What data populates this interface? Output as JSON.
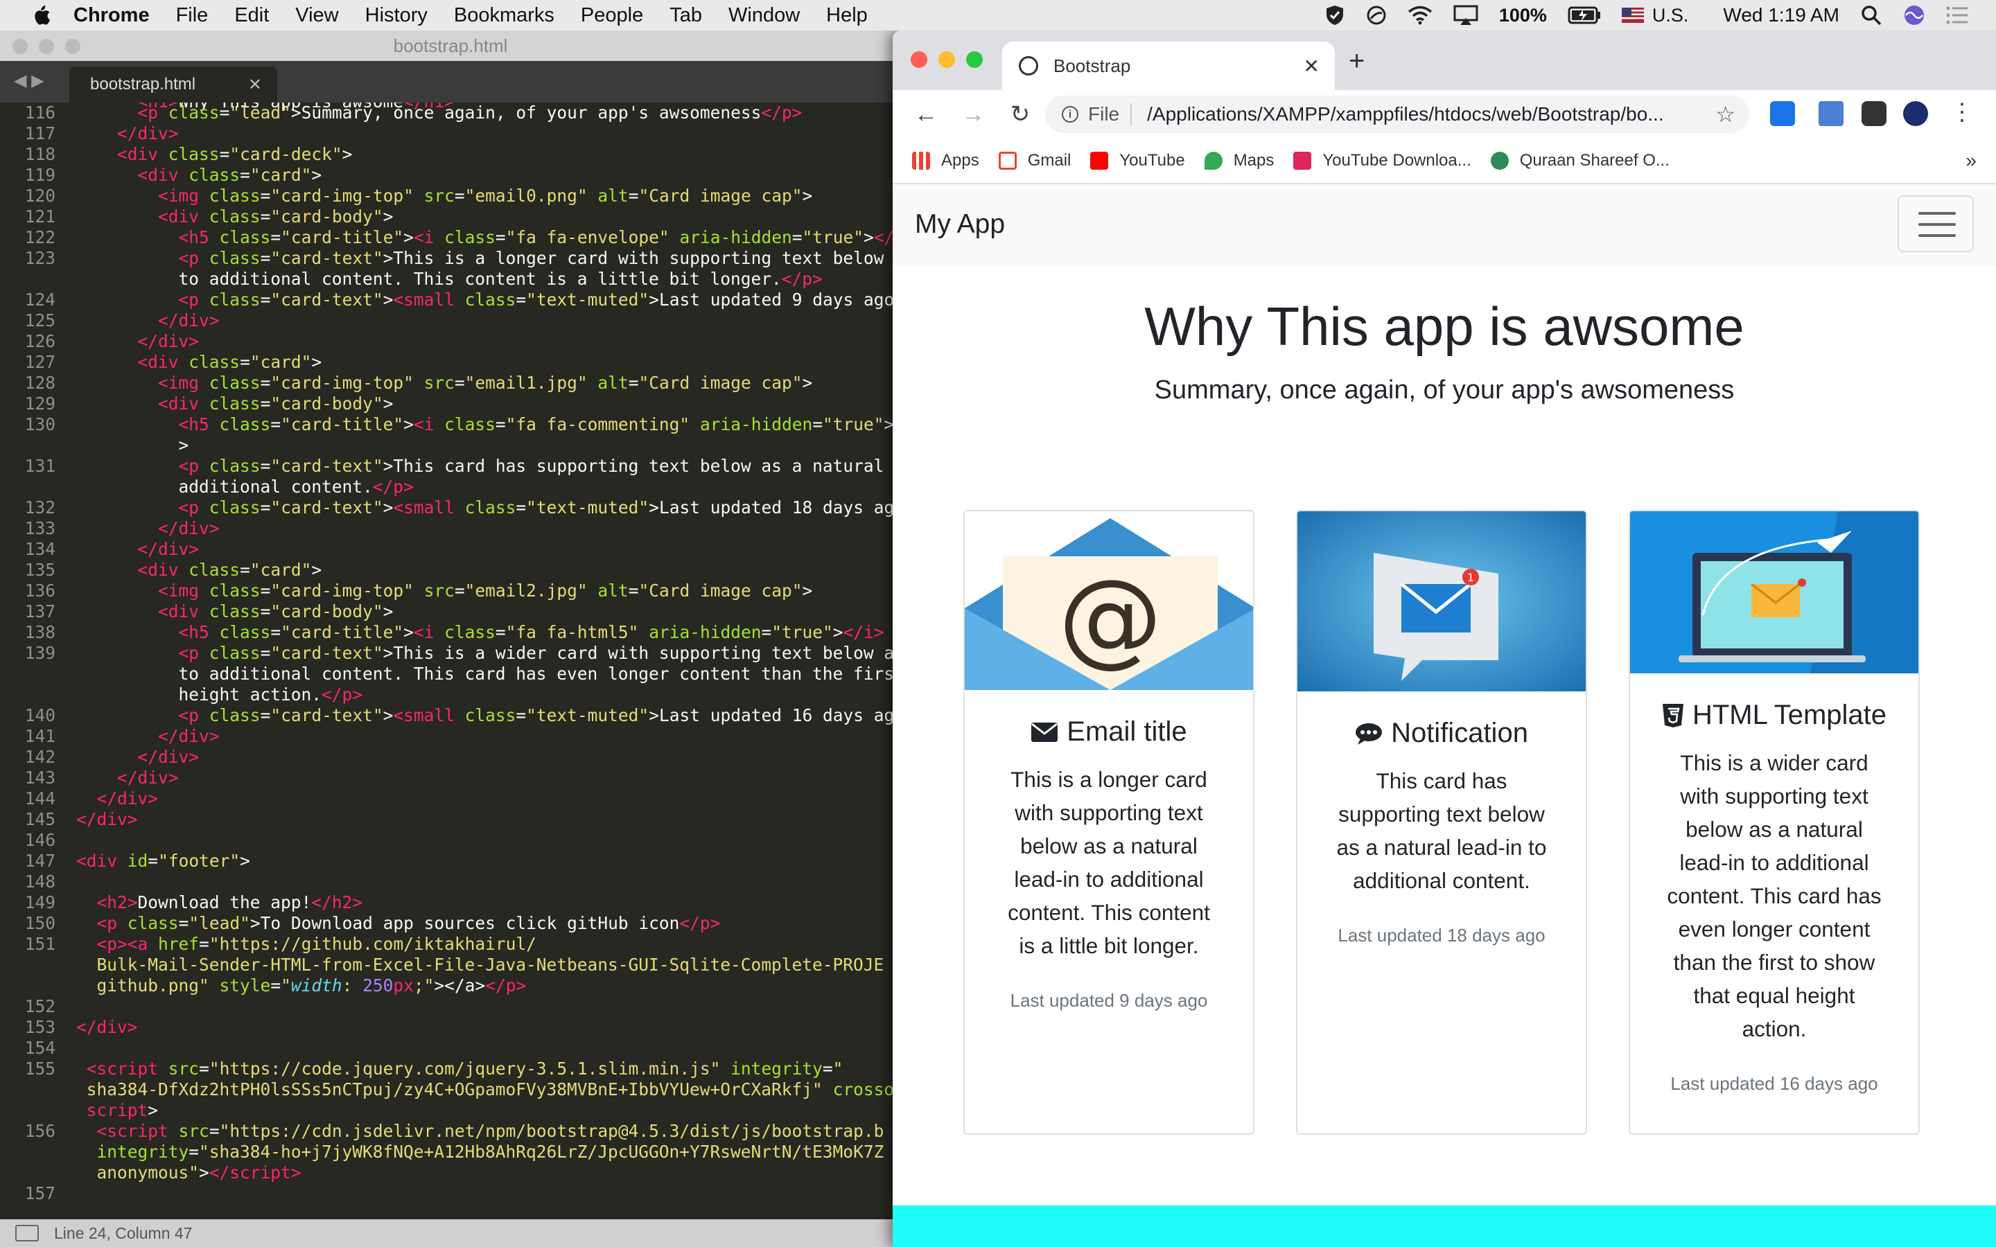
{
  "menubar": {
    "app": "Chrome",
    "items": [
      "File",
      "Edit",
      "View",
      "History",
      "Bookmarks",
      "People",
      "Tab",
      "Window",
      "Help"
    ],
    "battery": "100%",
    "input_source": "U.S.",
    "clock": "Wed 1:19 AM"
  },
  "editor": {
    "window_title": "bootstrap.html",
    "tab_label": "bootstrap.html",
    "status": "Line 24, Column 47",
    "line_numbers": [
      "116",
      "117",
      "118",
      "119",
      "120",
      "121",
      "122",
      "123",
      "",
      "124",
      "125",
      "126",
      "127",
      "128",
      "129",
      "130",
      "",
      "131",
      "",
      "132",
      "133",
      "134",
      "135",
      "136",
      "137",
      "138",
      "139",
      "",
      "",
      "140",
      "141",
      "142",
      "143",
      "144",
      "145",
      "146",
      "147",
      "148",
      "149",
      "150",
      "151",
      "",
      "",
      "152",
      "153",
      "154",
      "155",
      "",
      "",
      "156",
      "",
      ""
    ]
  },
  "chrome": {
    "tab_title": "Bootstrap",
    "omnibox_scheme": "File",
    "url": "/Applications/XAMPP/xamppfiles/htdocs/web/Bootstrap/bo...",
    "bookmarks": [
      "Apps",
      "Gmail",
      "YouTube",
      "Maps",
      "YouTube Downloa...",
      "Quraan Shareef O..."
    ],
    "more": "»"
  },
  "page": {
    "brand": "My App",
    "title": "Why This app is awsome",
    "lead": "Summary, once again, of your app's awsomeness",
    "cards": [
      {
        "title": "Email title",
        "icon": "envelope-icon",
        "text": "This is a longer card with supporting text below as a natural lead-in to additional content. This content is a little bit longer.",
        "muted": "Last updated 9 days ago"
      },
      {
        "title": "Notification",
        "icon": "commenting-icon",
        "text": "This card has supporting text below as a natural lead-in to additional content.",
        "muted": "Last updated 18 days ago"
      },
      {
        "title": "HTML Template",
        "icon": "html5-icon",
        "text": "This is a wider card with supporting text below as a natural lead-in to additional content. This card has even longer content than the first to show that equal height action.",
        "muted": "Last updated 16 days ago"
      }
    ],
    "footer_color": "#1ffdf9"
  }
}
